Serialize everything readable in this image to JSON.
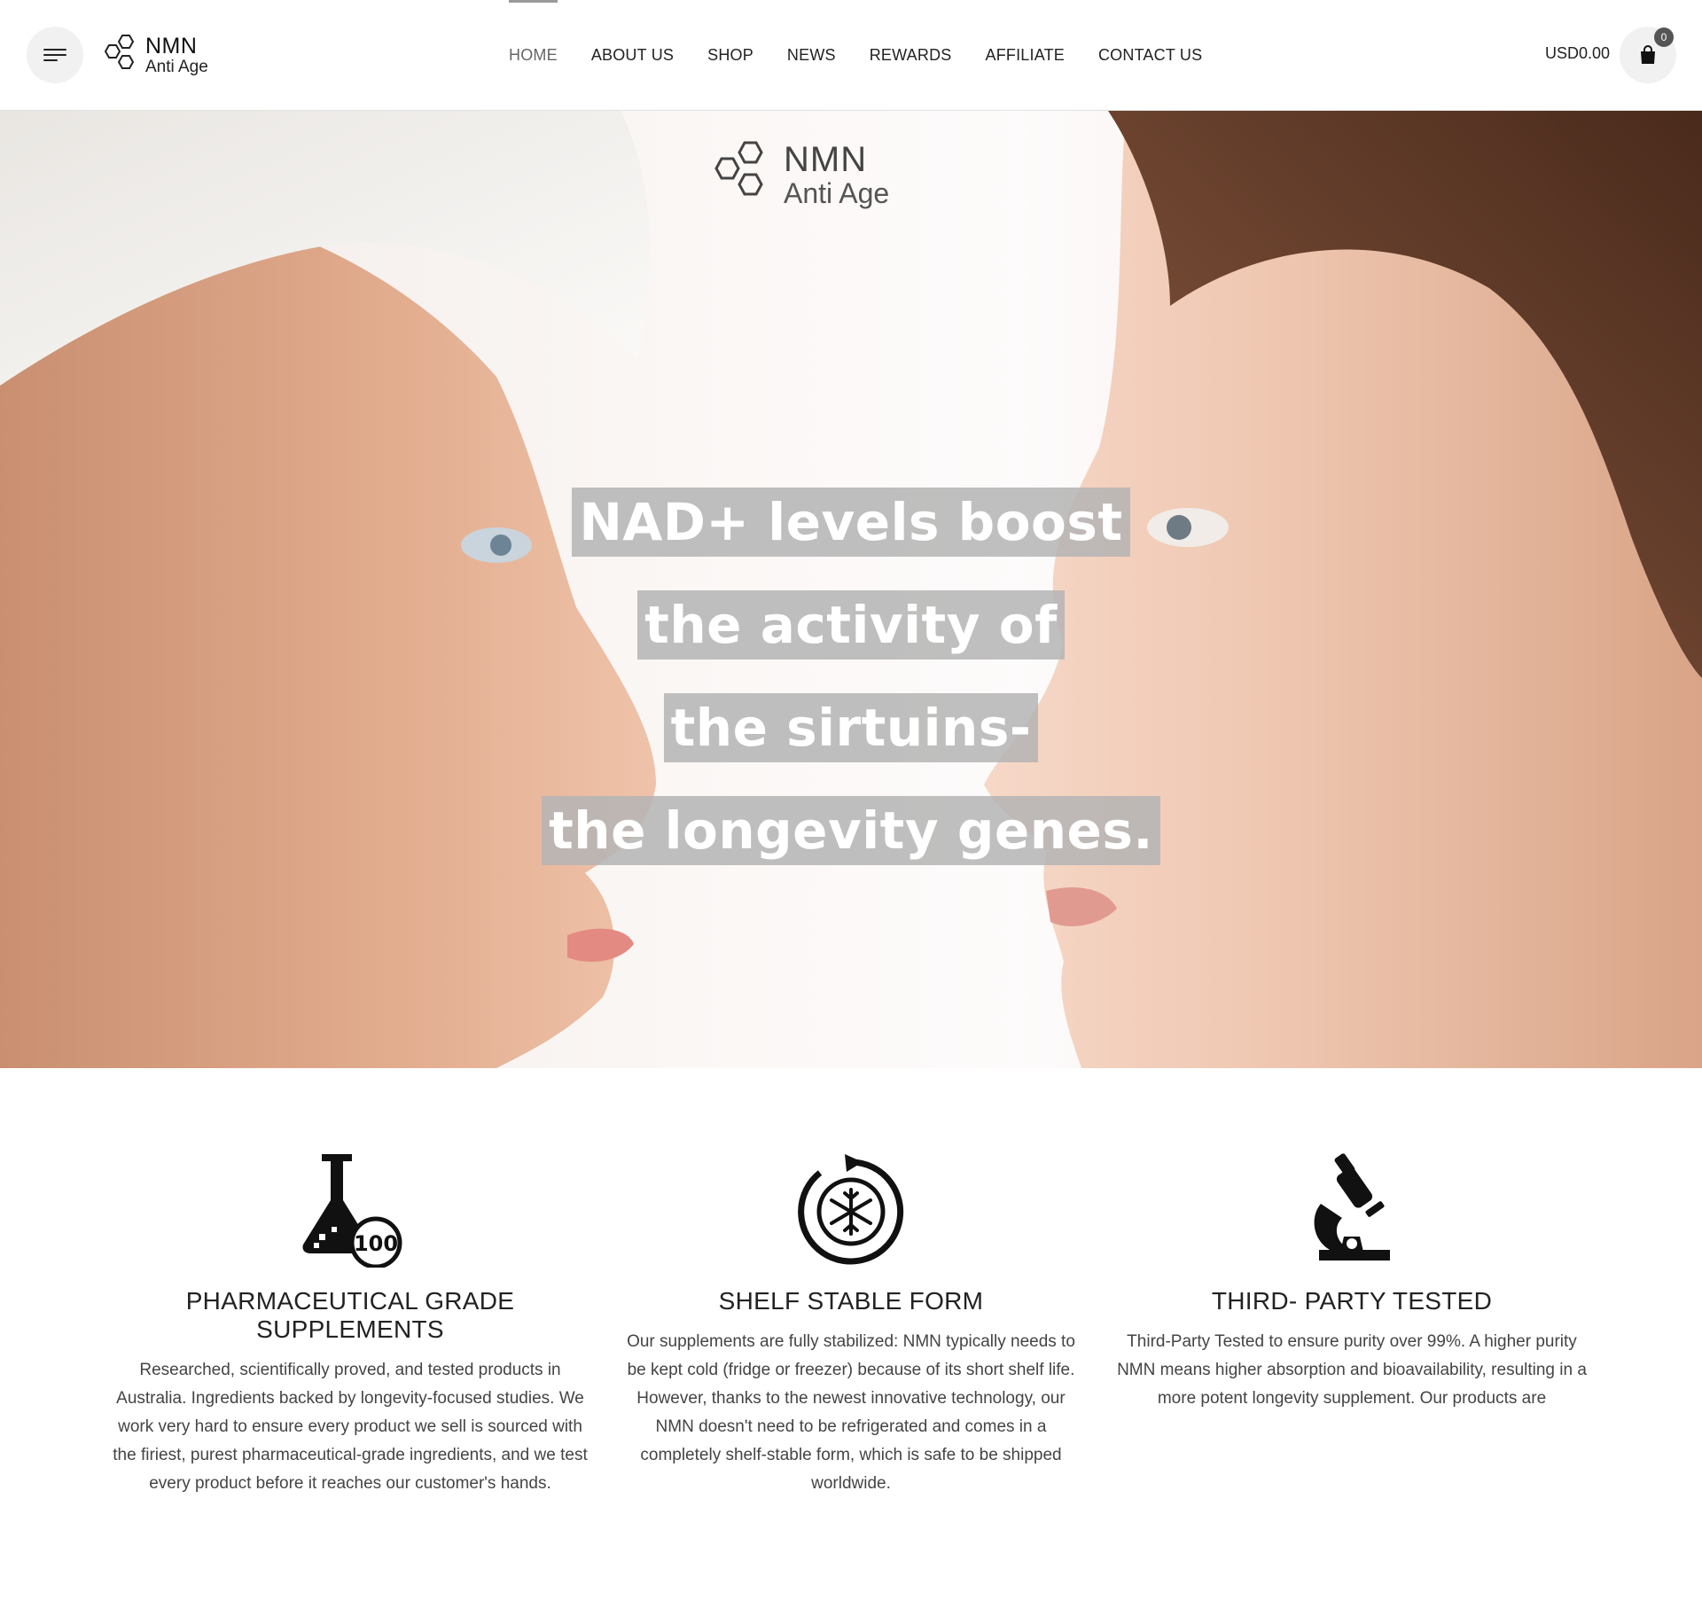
{
  "header": {
    "logo": {
      "line1": "NMN",
      "line2": "Anti Age"
    },
    "nav": [
      "HOME",
      "ABOUT US",
      "SHOP",
      "NEWS",
      "REWARDS",
      "AFFILIATE",
      "CONTACT US"
    ],
    "active_nav": "HOME",
    "cart_total": "USD0.00",
    "cart_count": "0"
  },
  "hero": {
    "logo": {
      "line1": "NMN",
      "line2": "Anti Age"
    },
    "lines": [
      "NAD+ levels boost",
      "the activity of",
      "the sirtuins-",
      "the longevity genes."
    ]
  },
  "features": [
    {
      "icon": "flask-100-icon",
      "title": "PHARMACEUTICAL GRADE SUPPLEMENTS",
      "text": "Researched, scientifically proved, and tested products in Australia. Ingredients backed by longevity-focused studies. We work very hard to ensure every product we sell is sourced with the firiest, purest pharmaceutical-grade ingredients, and we test every product before it reaches our customer's hands."
    },
    {
      "icon": "snowflake-cycle-icon",
      "title": "SHELF STABLE FORM",
      "text": "Our supplements are fully stabilized: NMN typically needs to be kept cold (fridge or freezer) because of its short shelf life. However, thanks to the newest innovative technology, our NMN doesn't need to be refrigerated and comes in a completely shelf-stable form, which is safe to be shipped worldwide."
    },
    {
      "icon": "microscope-icon",
      "title": "THIRD- PARTY TESTED",
      "text": "Third-Party Tested to ensure purity over 99%. A higher purity NMN means higher absorption and bioavailability, resulting in a more potent longevity supplement. Our products are"
    }
  ]
}
